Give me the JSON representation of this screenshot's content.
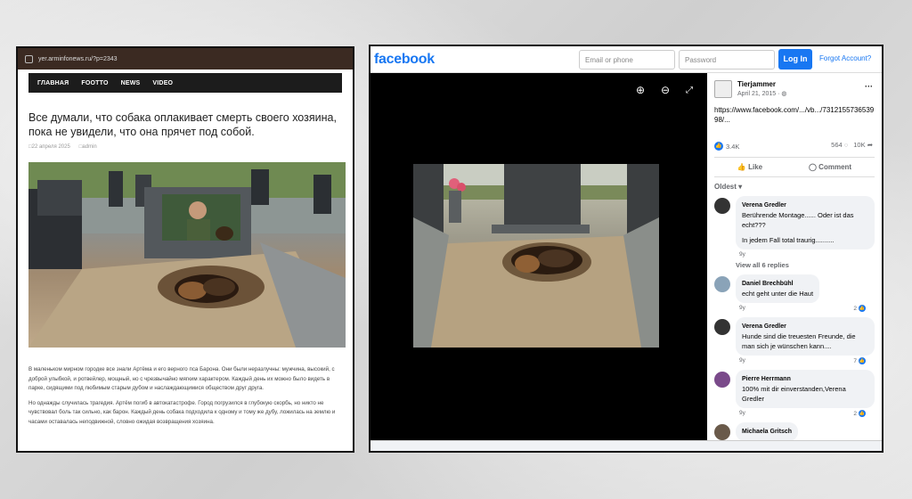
{
  "left_panel": {
    "url": "yer.arminfonews.ru/?p=2343",
    "nav": [
      "ГЛАВНАЯ",
      "FOOTTO",
      "NEWS",
      "VIDEO"
    ],
    "title": "Все думали, что собака оплакивает смерть своего хозяина, пока не увидели, что она прячет под собой.",
    "date": "22 апреля 2025",
    "author": "admin",
    "paragraphs": [
      "В маленьком мирном городке все знали Артёма и его верного пса Барона. Они были неразлучны: мужчина, высокий, с доброй улыбкой, и ротвейлер, мощный, но с чрезвычайно мягким характером. Каждый день их можно было видеть в парке, сидящими под любимым старым дубом и наслаждающимися обществом друг друга.",
      "Но однажды случилась трагедия. Артём погиб в автокатастрофе. Город погрузился в глубокую скорбь, но никто не чувствовал боль так сильно, как барон. Каждый день собака подходила к одному и тому же дубу, ложилась на землю и часами оставалась неподвижной, словно ожидая возвращения хозяина."
    ]
  },
  "facebook": {
    "logo": "facebook",
    "email_placeholder": "Email or phone",
    "password_placeholder": "Password",
    "login_label": "Log In",
    "forgot_label": "Forgot Account?",
    "post": {
      "author": "Tierjammer",
      "date": "April 21, 2015 · ",
      "link": "https://www.facebook.com/.../vb.../731215573653998/...",
      "reactions": "3.4K",
      "comments_count": "564",
      "shares_count": "10K",
      "like_label": "Like",
      "comment_label": "Comment",
      "sort_label": "Oldest"
    },
    "comments": [
      {
        "name": "Verena Gredler",
        "text": "Berührende Montage...... Oder ist das echt???",
        "text2": "In jedem Fall total traurig..........",
        "time": "9y",
        "likes": ""
      },
      {
        "name": "Daniel Brechbühl",
        "text": "echt geht unter die Haut",
        "time": "9y",
        "likes": "2"
      },
      {
        "name": "Verena Gredler",
        "text": "Hunde sind die treuesten Freunde, die man sich je wünschen kann....",
        "time": "9y",
        "likes": "7"
      },
      {
        "name": "Pierre Herrmann",
        "text": "100% mit dir einverstanden,Verena Gredler",
        "time": "9y",
        "likes": "2"
      },
      {
        "name": "Michaela Gritsch",
        "text": "",
        "time": "",
        "likes": ""
      }
    ],
    "view_replies": "View all 6 replies"
  }
}
